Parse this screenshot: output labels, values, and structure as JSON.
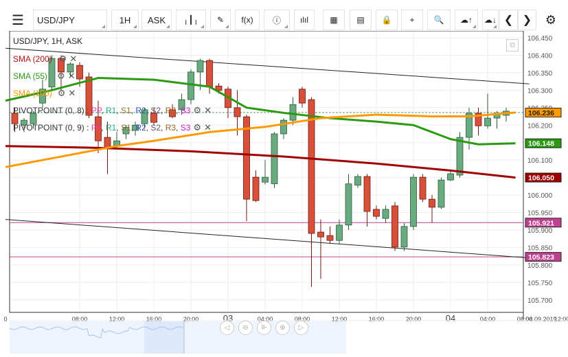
{
  "toolbar": {
    "menu_icon": "hamburger-icon",
    "symbol": "USD/JPY",
    "timeframe": "1H",
    "price_type": "ASK",
    "buttons": [
      {
        "name": "chart-type-button",
        "icon": "candles-icon",
        "glyph": "╷┃╷"
      },
      {
        "name": "drawing-button",
        "icon": "pencil-icon",
        "glyph": "✎"
      },
      {
        "name": "indicators-button",
        "icon": "function-icon",
        "glyph": "f(x)"
      },
      {
        "name": "info-button",
        "icon": "info-icon",
        "glyph": "ⓘ"
      },
      {
        "name": "volume-button",
        "icon": "bar-chart-icon",
        "glyph": "ılıl"
      },
      {
        "name": "calendar-button",
        "icon": "calendar-icon",
        "glyph": "▦"
      },
      {
        "name": "news-button",
        "icon": "document-icon",
        "glyph": "▤"
      },
      {
        "name": "lock-button",
        "icon": "lock-icon",
        "glyph": "🔒"
      },
      {
        "name": "crosshair-button",
        "icon": "crosshair-icon",
        "glyph": "+"
      },
      {
        "name": "zoom-button",
        "icon": "magnifier-icon",
        "glyph": "🔍"
      },
      {
        "name": "upload-button",
        "icon": "cloud-upload-icon",
        "glyph": "☁↑"
      },
      {
        "name": "download-button",
        "icon": "cloud-download-icon",
        "glyph": "☁↓"
      }
    ],
    "prev_icon": "chevron-left-icon",
    "next_icon": "chevron-right-icon",
    "settings_icon": "gear-icon"
  },
  "legend": {
    "title": "USD/JPY, 1H, ASK",
    "sma": [
      {
        "label": "SMA (200)",
        "color": "#b01010"
      },
      {
        "label": "SMA (55)",
        "color": "#2a9a10"
      },
      {
        "label": "SMA (100)",
        "color": "#ff9900"
      }
    ],
    "pivots": [
      {
        "label": "PIVOTPOINT (0, 8)",
        "sep": " : "
      },
      {
        "label": "PIVOTPOINT (0, 9)",
        "sep": " : "
      }
    ],
    "pivot_levels": [
      {
        "t": "PP",
        "c": "#e040a0"
      },
      {
        "t": "R1",
        "c": "#20b080"
      },
      {
        "t": "S1",
        "c": "#9a7030"
      },
      {
        "t": "R2",
        "c": "#3050c0"
      },
      {
        "t": "S2",
        "c": "#705070"
      },
      {
        "t": "R3",
        "c": "#a06020"
      },
      {
        "t": "S3",
        "c": "#d020d0"
      }
    ]
  },
  "chart_data": {
    "type": "candlestick",
    "ylim": [
      105.68,
      106.47
    ],
    "y_ticks": [
      "106.450",
      "106.400",
      "106.350",
      "106.300",
      "106.250",
      "106.200",
      "106.150",
      "106.100",
      "106.050",
      "106.000",
      "105.950",
      "105.900",
      "105.850",
      "105.800",
      "105.750",
      "105.700"
    ],
    "x_ticks": [
      {
        "h": 0,
        "label": "0"
      },
      {
        "h": 8,
        "label": "08:00"
      },
      {
        "h": 12,
        "label": "12:00"
      },
      {
        "h": 16,
        "label": "16:00"
      },
      {
        "h": 20,
        "label": "20:00"
      },
      {
        "h": 24,
        "label": "03",
        "major": true
      },
      {
        "h": 28,
        "label": "04:00"
      },
      {
        "h": 32,
        "label": "08:00"
      },
      {
        "h": 36,
        "label": "12:00"
      },
      {
        "h": 40,
        "label": "16:00"
      },
      {
        "h": 44,
        "label": "20:00"
      },
      {
        "h": 48,
        "label": "04",
        "major": true
      },
      {
        "h": 52,
        "label": "04:00"
      },
      {
        "h": 56,
        "label": "08:00"
      },
      {
        "h": 60,
        "label": "12:00"
      }
    ],
    "date_label": "04.09.2019",
    "up_color": "#6aaa80",
    "down_color": "#d9503a",
    "candles": [
      {
        "h": 1,
        "o": 106.234,
        "h_": 106.25,
        "l": 106.18,
        "c": 106.204
      },
      {
        "h": 2,
        "o": 106.2,
        "h_": 106.22,
        "l": 106.18,
        "c": 106.214
      },
      {
        "h": 3,
        "o": 106.204,
        "h_": 106.24,
        "l": 106.19,
        "c": 106.234
      },
      {
        "h": 4,
        "o": 106.263,
        "h_": 106.33,
        "l": 106.25,
        "c": 106.303
      },
      {
        "h": 5,
        "o": 106.309,
        "h_": 106.4,
        "l": 106.3,
        "c": 106.391
      },
      {
        "h": 6,
        "o": 106.391,
        "h_": 106.4,
        "l": 106.3,
        "c": 106.352
      },
      {
        "h": 7,
        "o": 106.352,
        "h_": 106.38,
        "l": 106.34,
        "c": 106.375
      },
      {
        "h": 8,
        "o": 106.371,
        "h_": 106.38,
        "l": 106.31,
        "c": 106.332
      },
      {
        "h": 9,
        "o": 106.338,
        "h_": 106.35,
        "l": 106.22,
        "c": 106.228
      },
      {
        "h": 10,
        "o": 106.224,
        "h_": 106.27,
        "l": 106.12,
        "c": 106.155
      },
      {
        "h": 11,
        "o": 106.165,
        "h_": 106.21,
        "l": 106.06,
        "c": 106.136
      },
      {
        "h": 12,
        "o": 106.141,
        "h_": 106.18,
        "l": 106.13,
        "c": 106.155
      },
      {
        "h": 13,
        "o": 106.175,
        "h_": 106.2,
        "l": 106.16,
        "c": 106.194
      },
      {
        "h": 14,
        "o": 106.185,
        "h_": 106.21,
        "l": 106.17,
        "c": 106.2
      },
      {
        "h": 15,
        "o": 106.204,
        "h_": 106.25,
        "l": 106.19,
        "c": 106.244
      },
      {
        "h": 16,
        "o": 106.234,
        "h_": 106.25,
        "l": 106.2,
        "c": 106.208
      },
      {
        "h": 18,
        "o": 106.244,
        "h_": 106.26,
        "l": 106.22,
        "c": 106.224
      },
      {
        "h": 19,
        "o": 106.244,
        "h_": 106.29,
        "l": 106.23,
        "c": 106.273
      },
      {
        "h": 20,
        "o": 106.273,
        "h_": 106.36,
        "l": 106.26,
        "c": 106.352
      },
      {
        "h": 21,
        "o": 106.352,
        "h_": 106.39,
        "l": 106.3,
        "c": 106.385
      },
      {
        "h": 22,
        "o": 106.385,
        "h_": 106.39,
        "l": 106.29,
        "c": 106.309
      },
      {
        "h": 23,
        "o": 106.312,
        "h_": 106.32,
        "l": 106.29,
        "c": 106.299
      },
      {
        "h": 24,
        "o": 106.303,
        "h_": 106.31,
        "l": 106.22,
        "c": 106.25
      },
      {
        "h": 25,
        "o": 106.25,
        "h_": 106.3,
        "l": 106.17,
        "c": 106.224
      },
      {
        "h": 26,
        "o": 106.224,
        "h_": 106.23,
        "l": 105.925,
        "c": 105.988
      },
      {
        "h": 27,
        "o": 106.051,
        "h_": 106.07,
        "l": 105.98,
        "c": 105.984
      },
      {
        "h": 28,
        "o": 106.037,
        "h_": 106.1,
        "l": 106.03,
        "c": 106.051
      },
      {
        "h": 29,
        "o": 106.032,
        "h_": 106.18,
        "l": 106.02,
        "c": 106.175
      },
      {
        "h": 30,
        "o": 106.175,
        "h_": 106.22,
        "l": 106.16,
        "c": 106.214
      },
      {
        "h": 31,
        "o": 106.214,
        "h_": 106.28,
        "l": 106.2,
        "c": 106.259
      },
      {
        "h": 32,
        "o": 106.303,
        "h_": 106.31,
        "l": 106.25,
        "c": 106.263
      },
      {
        "h": 33,
        "o": 106.273,
        "h_": 106.28,
        "l": 105.737,
        "c": 105.89
      },
      {
        "h": 34,
        "o": 105.894,
        "h_": 105.93,
        "l": 105.76,
        "c": 105.88
      },
      {
        "h": 35,
        "o": 105.884,
        "h_": 105.91,
        "l": 105.86,
        "c": 105.87
      },
      {
        "h": 36,
        "o": 105.87,
        "h_": 105.93,
        "l": 105.86,
        "c": 105.914
      },
      {
        "h": 37,
        "o": 105.914,
        "h_": 106.06,
        "l": 105.9,
        "c": 106.032
      },
      {
        "h": 38,
        "o": 106.028,
        "h_": 106.06,
        "l": 106.02,
        "c": 106.053
      },
      {
        "h": 39,
        "o": 106.053,
        "h_": 106.06,
        "l": 105.91,
        "c": 105.953
      },
      {
        "h": 40,
        "o": 105.959,
        "h_": 105.97,
        "l": 105.93,
        "c": 105.939
      },
      {
        "h": 41,
        "o": 105.933,
        "h_": 105.97,
        "l": 105.92,
        "c": 105.959
      },
      {
        "h": 42,
        "o": 105.969,
        "h_": 105.98,
        "l": 105.84,
        "c": 105.851
      },
      {
        "h": 43,
        "o": 105.851,
        "h_": 105.92,
        "l": 105.84,
        "c": 105.91
      },
      {
        "h": 44,
        "o": 105.91,
        "h_": 106.06,
        "l": 105.9,
        "c": 106.051
      },
      {
        "h": 45,
        "o": 106.051,
        "h_": 106.06,
        "l": 105.98,
        "c": 105.988
      },
      {
        "h": 46,
        "o": 105.988,
        "h_": 106.0,
        "l": 105.92,
        "c": 105.965
      },
      {
        "h": 47,
        "o": 105.965,
        "h_": 106.05,
        "l": 105.96,
        "c": 106.043
      },
      {
        "h": 48,
        "o": 106.043,
        "h_": 106.07,
        "l": 106.04,
        "c": 106.061
      },
      {
        "h": 49,
        "o": 106.057,
        "h_": 106.18,
        "l": 106.05,
        "c": 106.165
      },
      {
        "h": 50,
        "o": 106.165,
        "h_": 106.25,
        "l": 106.13,
        "c": 106.234
      },
      {
        "h": 51,
        "o": 106.234,
        "h_": 106.25,
        "l": 106.17,
        "c": 106.198
      },
      {
        "h": 52,
        "o": 106.198,
        "h_": 106.29,
        "l": 106.19,
        "c": 106.22
      },
      {
        "h": 53,
        "o": 106.22,
        "h_": 106.24,
        "l": 106.19,
        "c": 106.234
      },
      {
        "h": 54,
        "o": 106.228,
        "h_": 106.25,
        "l": 106.21,
        "c": 106.24
      }
    ],
    "sma200": [
      [
        0,
        106.14
      ],
      [
        10,
        106.135
      ],
      [
        20,
        106.125
      ],
      [
        30,
        106.11
      ],
      [
        40,
        106.09
      ],
      [
        48,
        106.07
      ],
      [
        55,
        106.05
      ]
    ],
    "sma55": [
      [
        0,
        106.27
      ],
      [
        5,
        106.3
      ],
      [
        10,
        106.335
      ],
      [
        16,
        106.33
      ],
      [
        22,
        106.31
      ],
      [
        26,
        106.25
      ],
      [
        30,
        106.235
      ],
      [
        35,
        106.22
      ],
      [
        40,
        106.21
      ],
      [
        44,
        106.2
      ],
      [
        46,
        106.18
      ],
      [
        48,
        106.16
      ],
      [
        51,
        106.145
      ],
      [
        55,
        106.148
      ]
    ],
    "sma100": [
      [
        0,
        106.08
      ],
      [
        6,
        106.11
      ],
      [
        12,
        106.14
      ],
      [
        16,
        106.155
      ],
      [
        22,
        106.18
      ],
      [
        28,
        106.195
      ],
      [
        34,
        106.22
      ],
      [
        40,
        106.23
      ],
      [
        46,
        106.225
      ],
      [
        50,
        106.225
      ],
      [
        55,
        106.236
      ]
    ],
    "trendlines": [
      {
        "from": [
          0,
          106.42
        ],
        "to": [
          56.5,
          106.318
        ],
        "color": "#222"
      },
      {
        "from": [
          0,
          105.93
        ],
        "to": [
          56.5,
          105.82
        ],
        "color": "#222"
      }
    ],
    "hlines": [
      {
        "value": 105.921,
        "color": "#c04090"
      },
      {
        "value": 105.823,
        "color": "#c04090"
      },
      {
        "value": 106.236,
        "color": "#5a9a6a",
        "dashed": true
      }
    ],
    "price_labels": [
      {
        "text": "106.236",
        "value": 106.236,
        "bg": "#ff9900",
        "fg": "#222"
      },
      {
        "text": "106.148",
        "value": 106.148,
        "bg": "#2a9a10",
        "fg": "#fff"
      },
      {
        "text": "106.050",
        "value": 106.05,
        "bg": "#a00000",
        "fg": "#fff"
      },
      {
        "text": "105.921",
        "value": 105.921,
        "bg": "#c04090",
        "fg": "#fff"
      },
      {
        "text": "105.823",
        "value": 105.823,
        "bg": "#c04090",
        "fg": "#fff"
      }
    ]
  },
  "nav_buttons": [
    {
      "name": "scroll-left-button",
      "icon": "chevron-left-icon",
      "glyph": "◁"
    },
    {
      "name": "zoom-out-button",
      "icon": "zoom-out-icon",
      "glyph": "⊖"
    },
    {
      "name": "reset-button",
      "icon": "reset-icon",
      "glyph": "⊪"
    },
    {
      "name": "zoom-in-button",
      "icon": "zoom-in-icon",
      "glyph": "⊕"
    },
    {
      "name": "scroll-right-button",
      "icon": "chevron-right-icon",
      "glyph": "▷"
    }
  ]
}
